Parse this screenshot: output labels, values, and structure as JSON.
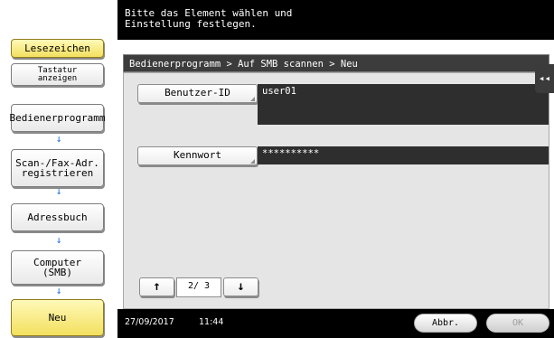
{
  "header": {
    "message": "Bitte das Element wählen und\nEinstellung festlegen."
  },
  "sidebar": {
    "bookmark_label": "Lesezeichen",
    "keyboard_label_line1": "Tastatur",
    "keyboard_label_line2": "anzeigen",
    "nav": [
      {
        "label": "Bedienerprogramm"
      },
      {
        "label_line1": "Scan-/Fax-Adr.",
        "label_line2": "registrieren"
      },
      {
        "label": "Adressbuch"
      },
      {
        "label_line1": "Computer",
        "label_line2": "(SMB)"
      },
      {
        "label": "Neu"
      }
    ],
    "arrow_glyph": "↓"
  },
  "main": {
    "breadcrumb": "Bedienerprogramm > Auf SMB scannen > Neu",
    "fields": [
      {
        "label": "Benutzer-ID",
        "value": "user01"
      },
      {
        "label": "Kennwort",
        "value": "**********"
      }
    ],
    "pager": {
      "current": "2",
      "separator": "/",
      "total": "3"
    }
  },
  "sidetab_glyph": "◂◂",
  "status": {
    "date": "27/09/2017",
    "time": "11:44",
    "cancel_label": "Abbr.",
    "ok_label": "OK"
  },
  "colors": {
    "accent_arrow": "#1766d8",
    "highlight_yellow": "#f3e05f",
    "dark_bar": "#000000"
  }
}
